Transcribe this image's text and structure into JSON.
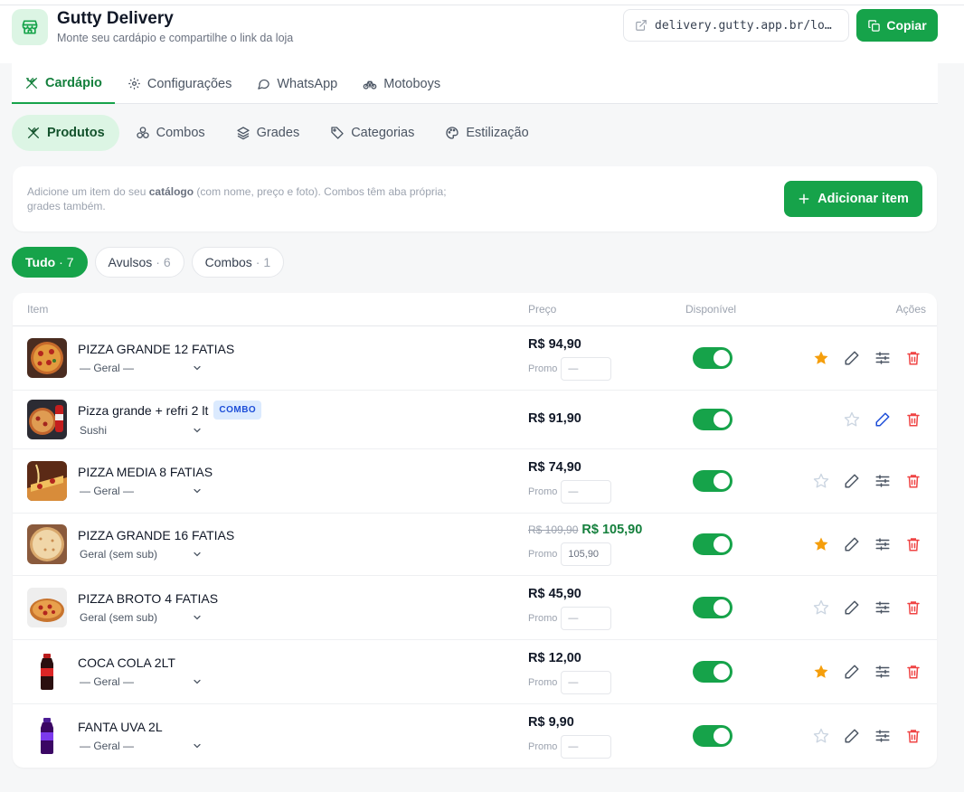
{
  "header": {
    "title": "Gutty Delivery",
    "subtitle": "Monte seu cardápio e compartilhe o link da loja",
    "url": "delivery.gutty.app.br/lo…",
    "copy_label": "Copiar"
  },
  "main_tabs": [
    {
      "label": "Cardápio",
      "icon": "utensils-icon",
      "active": true
    },
    {
      "label": "Configurações",
      "icon": "gear-icon",
      "active": false
    },
    {
      "label": "WhatsApp",
      "icon": "chat-bubble-icon",
      "active": false
    },
    {
      "label": "Motoboys",
      "icon": "bike-icon",
      "active": false
    }
  ],
  "sub_tabs": [
    {
      "label": "Produtos",
      "icon": "utensils-icon",
      "active": true
    },
    {
      "label": "Combos",
      "icon": "circles-icon",
      "active": false
    },
    {
      "label": "Grades",
      "icon": "layers-icon",
      "active": false
    },
    {
      "label": "Categorias",
      "icon": "tag-icon",
      "active": false
    },
    {
      "label": "Estilização",
      "icon": "palette-icon",
      "active": false
    }
  ],
  "info": {
    "text_before": "Adicione um item do seu ",
    "text_bold": "catálogo",
    "text_after": " (com nome, preço e foto). Combos têm aba própria; grades também.",
    "add_label": "Adicionar item"
  },
  "filters": [
    {
      "label": "Tudo",
      "count": "· 7",
      "active": true
    },
    {
      "label": "Avulsos",
      "count": "· 6",
      "active": false
    },
    {
      "label": "Combos",
      "count": "· 1",
      "active": false
    }
  ],
  "table": {
    "headers": {
      "item": "Item",
      "price": "Preço",
      "available": "Disponível",
      "actions": "Ações"
    },
    "promo_label": "Promo",
    "rows": [
      {
        "name": "PIZZA GRANDE 12 FATIAS",
        "category": "— Geral —",
        "price": "R$ 94,90",
        "promo": "—",
        "starred": true,
        "combo": false
      },
      {
        "name": "Pizza grande + refri 2 lt",
        "badge": "COMBO",
        "category": "Sushi",
        "price": "R$ 91,90",
        "starred": false,
        "combo": true
      },
      {
        "name": "PIZZA MEDIA 8 FATIAS",
        "category": "— Geral —",
        "price": "R$ 74,90",
        "promo": "—",
        "starred": false,
        "combo": false
      },
      {
        "name": "PIZZA GRANDE 16 FATIAS",
        "category": "Geral (sem sub)",
        "old_price": "R$ 109,90",
        "price": "R$ 105,90",
        "promo": "105,90",
        "starred": true,
        "combo": false
      },
      {
        "name": "PIZZA BROTO 4 FATIAS",
        "category": "Geral (sem sub)",
        "price": "R$ 45,90",
        "promo": "—",
        "starred": false,
        "combo": false
      },
      {
        "name": "COCA COLA 2LT",
        "category": "— Geral —",
        "price": "R$ 12,00",
        "promo": "—",
        "starred": true,
        "combo": false
      },
      {
        "name": "FANTA UVA 2L",
        "category": "— Geral —",
        "price": "R$ 9,90",
        "promo": "—",
        "starred": false,
        "combo": false
      }
    ]
  },
  "colors": {
    "accent": "#16a34a",
    "star": "#f59e0b",
    "delete": "#ef4444",
    "edit_combo": "#1d4ed8"
  }
}
